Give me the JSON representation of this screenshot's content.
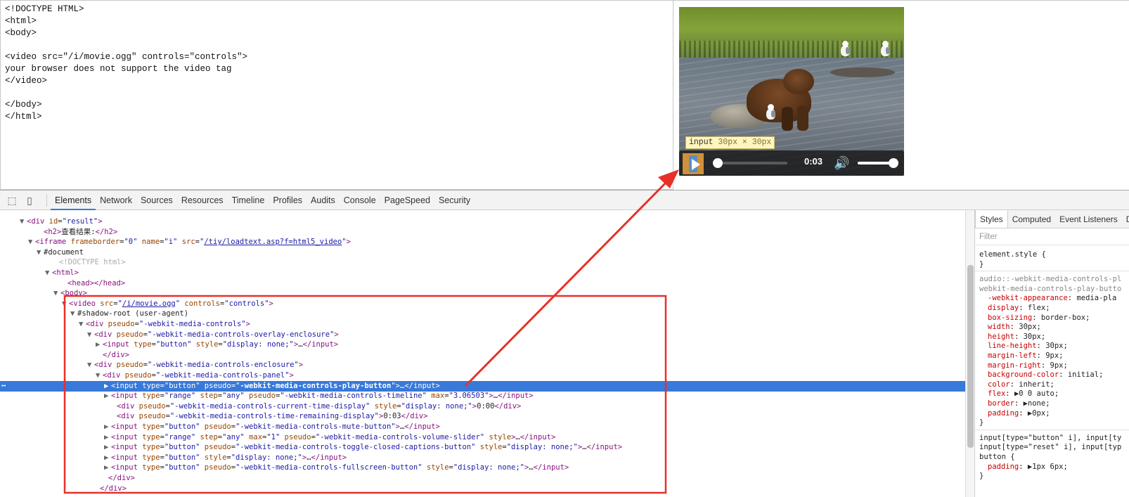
{
  "editor": {
    "lines": [
      "<!DOCTYPE HTML>",
      "<html>",
      "<body>",
      "",
      "<video src=\"/i/movie.ogg\" controls=\"controls\">",
      "your browser does not support the video tag",
      "</video>",
      "",
      "</body>",
      "</html>"
    ]
  },
  "video": {
    "tooltip_tag": "input",
    "tooltip_dims": "30px × 30px",
    "time_display": "0:03",
    "play_icon": "play-icon",
    "mute_icon": "speaker-icon"
  },
  "devtools": {
    "toolbar_icons": [
      "inspect-icon",
      "device-icon"
    ],
    "tabs": [
      "Elements",
      "Network",
      "Sources",
      "Resources",
      "Timeline",
      "Profiles",
      "Audits",
      "Console",
      "PageSpeed",
      "Security"
    ],
    "active_tab": "Elements",
    "dom_lines": [
      {
        "indent": 38,
        "tri": "▼",
        "html": "<span class='t'>&lt;div</span> <span class='a'>id</span>=<span class='v'>\"result\"</span><span class='t'>&gt;</span>"
      },
      {
        "indent": 62,
        "tri": "",
        "html": "<span class='t'>&lt;h2&gt;</span>查看结果:<span class='t'>&lt;/h2&gt;</span>"
      },
      {
        "indent": 50,
        "tri": "▼",
        "html": "<span class='t'>&lt;iframe</span> <span class='a'>frameborder</span>=<span class='v'>\"0\"</span> <span class='a'>name</span>=<span class='v'>\"i\"</span> <span class='a'>src</span>=<span class='v'>\"</span><span class='u'>/tiy/loadtext.asp?f=html5_video</span><span class='v'>\"</span><span class='t'>&gt;</span>"
      },
      {
        "indent": 62,
        "tri": "▼",
        "html": "#document"
      },
      {
        "indent": 84,
        "tri": "",
        "html": "<span class='g'>&lt;!DOCTYPE html&gt;</span>"
      },
      {
        "indent": 74,
        "tri": "▼",
        "html": "<span class='t'>&lt;html&gt;</span>"
      },
      {
        "indent": 96,
        "tri": "",
        "html": "<span class='t'>&lt;head&gt;&lt;/head&gt;</span>"
      },
      {
        "indent": 86,
        "tri": "▼",
        "html": "<span class='t'>&lt;body&gt;</span>"
      },
      {
        "indent": 98,
        "tri": "▼",
        "html": "<span class='t'>&lt;video</span> <span class='a'>src</span>=<span class='v'>\"</span><span class='u'>/i/movie.ogg</span><span class='v'>\"</span> <span class='a'>controls</span>=<span class='v'>\"controls\"</span><span class='t'>&gt;</span>"
      },
      {
        "indent": 110,
        "tri": "▼",
        "html": "#shadow-root (user-agent)"
      },
      {
        "indent": 122,
        "tri": "▼",
        "html": "<span class='t'>&lt;div</span> <span class='a'>pseudo</span>=<span class='v'>\"-webkit-media-controls\"</span><span class='t'>&gt;</span>"
      },
      {
        "indent": 134,
        "tri": "▼",
        "html": "<span class='t'>&lt;div</span> <span class='a'>pseudo</span>=<span class='v'>\"-webkit-media-controls-overlay-enclosure\"</span><span class='t'>&gt;</span>"
      },
      {
        "indent": 146,
        "tri": "▶",
        "html": "<span class='t'>&lt;input</span> <span class='a'>type</span>=<span class='v'>\"button\"</span> <span class='a'>style</span>=<span class='v'>\"display: none;\"</span><span class='t'>&gt;</span>…<span class='t'>&lt;/input&gt;</span>"
      },
      {
        "indent": 146,
        "tri": "",
        "html": "<span class='t'>&lt;/div&gt;</span>"
      },
      {
        "indent": 134,
        "tri": "▼",
        "html": "<span class='t'>&lt;div</span> <span class='a'>pseudo</span>=<span class='v'>\"-webkit-media-controls-enclosure\"</span><span class='t'>&gt;</span>"
      },
      {
        "indent": 146,
        "tri": "▼",
        "html": "<span class='t'>&lt;div</span> <span class='a'>pseudo</span>=<span class='v'>\"-webkit-media-controls-panel\"</span><span class='t'>&gt;</span>"
      },
      {
        "indent": 158,
        "tri": "▶",
        "sel": true,
        "html": "<span class='t'>&lt;input</span> <span class='a'>type</span>=<span class='v'>\"button\"</span> <span class='a'>pseudo</span>=<span class='v'>\"<b>-webkit-media-controls-play-button</b>\"</span><span class='t'>&gt;</span>…<span class='t'>&lt;/input&gt;</span>"
      },
      {
        "indent": 158,
        "tri": "▶",
        "html": "<span class='t'>&lt;input</span> <span class='a'>type</span>=<span class='v'>\"range\"</span> <span class='a'>step</span>=<span class='v'>\"any\"</span> <span class='a'>pseudo</span>=<span class='v'>\"-webkit-media-controls-timeline\"</span> <span class='a'>max</span>=<span class='v'>\"3.06503\"</span><span class='t'>&gt;</span>…<span class='t'>&lt;/input&gt;</span>"
      },
      {
        "indent": 166,
        "tri": "",
        "html": "<span class='t'>&lt;div</span> <span class='a'>pseudo</span>=<span class='v'>\"-webkit-media-controls-current-time-display\"</span> <span class='a'>style</span>=<span class='v'>\"display: none;\"</span><span class='t'>&gt;</span>0:00<span class='t'>&lt;/div&gt;</span>"
      },
      {
        "indent": 166,
        "tri": "",
        "html": "<span class='t'>&lt;div</span> <span class='a'>pseudo</span>=<span class='v'>\"-webkit-media-controls-time-remaining-display\"</span><span class='t'>&gt;</span>0:03<span class='t'>&lt;/div&gt;</span>"
      },
      {
        "indent": 158,
        "tri": "▶",
        "html": "<span class='t'>&lt;input</span> <span class='a'>type</span>=<span class='v'>\"button\"</span> <span class='a'>pseudo</span>=<span class='v'>\"-webkit-media-controls-mute-button\"</span><span class='t'>&gt;</span>…<span class='t'>&lt;/input&gt;</span>"
      },
      {
        "indent": 158,
        "tri": "▶",
        "html": "<span class='t'>&lt;input</span> <span class='a'>type</span>=<span class='v'>\"range\"</span> <span class='a'>step</span>=<span class='v'>\"any\"</span> <span class='a'>max</span>=<span class='v'>\"1\"</span> <span class='a'>pseudo</span>=<span class='v'>\"-webkit-media-controls-volume-slider\"</span> <span class='a'>style</span><span class='t'>&gt;</span>…<span class='t'>&lt;/input&gt;</span>"
      },
      {
        "indent": 158,
        "tri": "▶",
        "html": "<span class='t'>&lt;input</span> <span class='a'>type</span>=<span class='v'>\"button\"</span> <span class='a'>pseudo</span>=<span class='v'>\"-webkit-media-controls-toggle-closed-captions-button\"</span> <span class='a'>style</span>=<span class='v'>\"display: none;\"</span><span class='t'>&gt;</span>…<span class='t'>&lt;/input&gt;</span>"
      },
      {
        "indent": 158,
        "tri": "▶",
        "html": "<span class='t'>&lt;input</span> <span class='a'>type</span>=<span class='v'>\"button\"</span> <span class='a'>style</span>=<span class='v'>\"display: none;\"</span><span class='t'>&gt;</span>…<span class='t'>&lt;/input&gt;</span>"
      },
      {
        "indent": 158,
        "tri": "▶",
        "html": "<span class='t'>&lt;input</span> <span class='a'>type</span>=<span class='v'>\"button\"</span> <span class='a'>pseudo</span>=<span class='v'>\"-webkit-media-controls-fullscreen-button\"</span> <span class='a'>style</span>=<span class='v'>\"display: none;\"</span><span class='t'>&gt;</span>…<span class='t'>&lt;/input&gt;</span>"
      },
      {
        "indent": 154,
        "tri": "",
        "html": "<span class='t'>&lt;/div&gt;</span>"
      },
      {
        "indent": 142,
        "tri": "",
        "html": "<span class='t'>&lt;/div&gt;</span>"
      }
    ],
    "styles": {
      "tabs": [
        "Styles",
        "Computed",
        "Event Listeners",
        "D"
      ],
      "active": "Styles",
      "filter_placeholder": "Filter",
      "element_style": "element.style {",
      "close_brace": "}",
      "rule1_selector": [
        "audio::-webkit-media-controls-pl",
        "webkit-media-controls-play-butto"
      ],
      "rule1_props": [
        [
          "-webkit-appearance",
          "media-pla"
        ],
        [
          "display",
          "flex;"
        ],
        [
          "box-sizing",
          "border-box;"
        ],
        [
          "width",
          "30px;"
        ],
        [
          "height",
          "30px;"
        ],
        [
          "line-height",
          "30px;"
        ],
        [
          "margin-left",
          "9px;"
        ],
        [
          "margin-right",
          "9px;"
        ],
        [
          "background-color",
          "initial;"
        ],
        [
          "color",
          "inherit;"
        ],
        [
          "flex",
          "▶0 0 auto;"
        ],
        [
          "border",
          "▶none;"
        ],
        [
          "padding",
          "▶0px;"
        ]
      ],
      "rule2_selector": [
        "input[type=\"button\" i], input[ty",
        "input[type=\"reset\" i], input[typ",
        "button {"
      ],
      "rule2_props": [
        [
          "padding",
          "▶1px 6px;"
        ]
      ]
    }
  },
  "colors": {
    "selection": "#3879d9",
    "annotation": "#e8302a"
  }
}
